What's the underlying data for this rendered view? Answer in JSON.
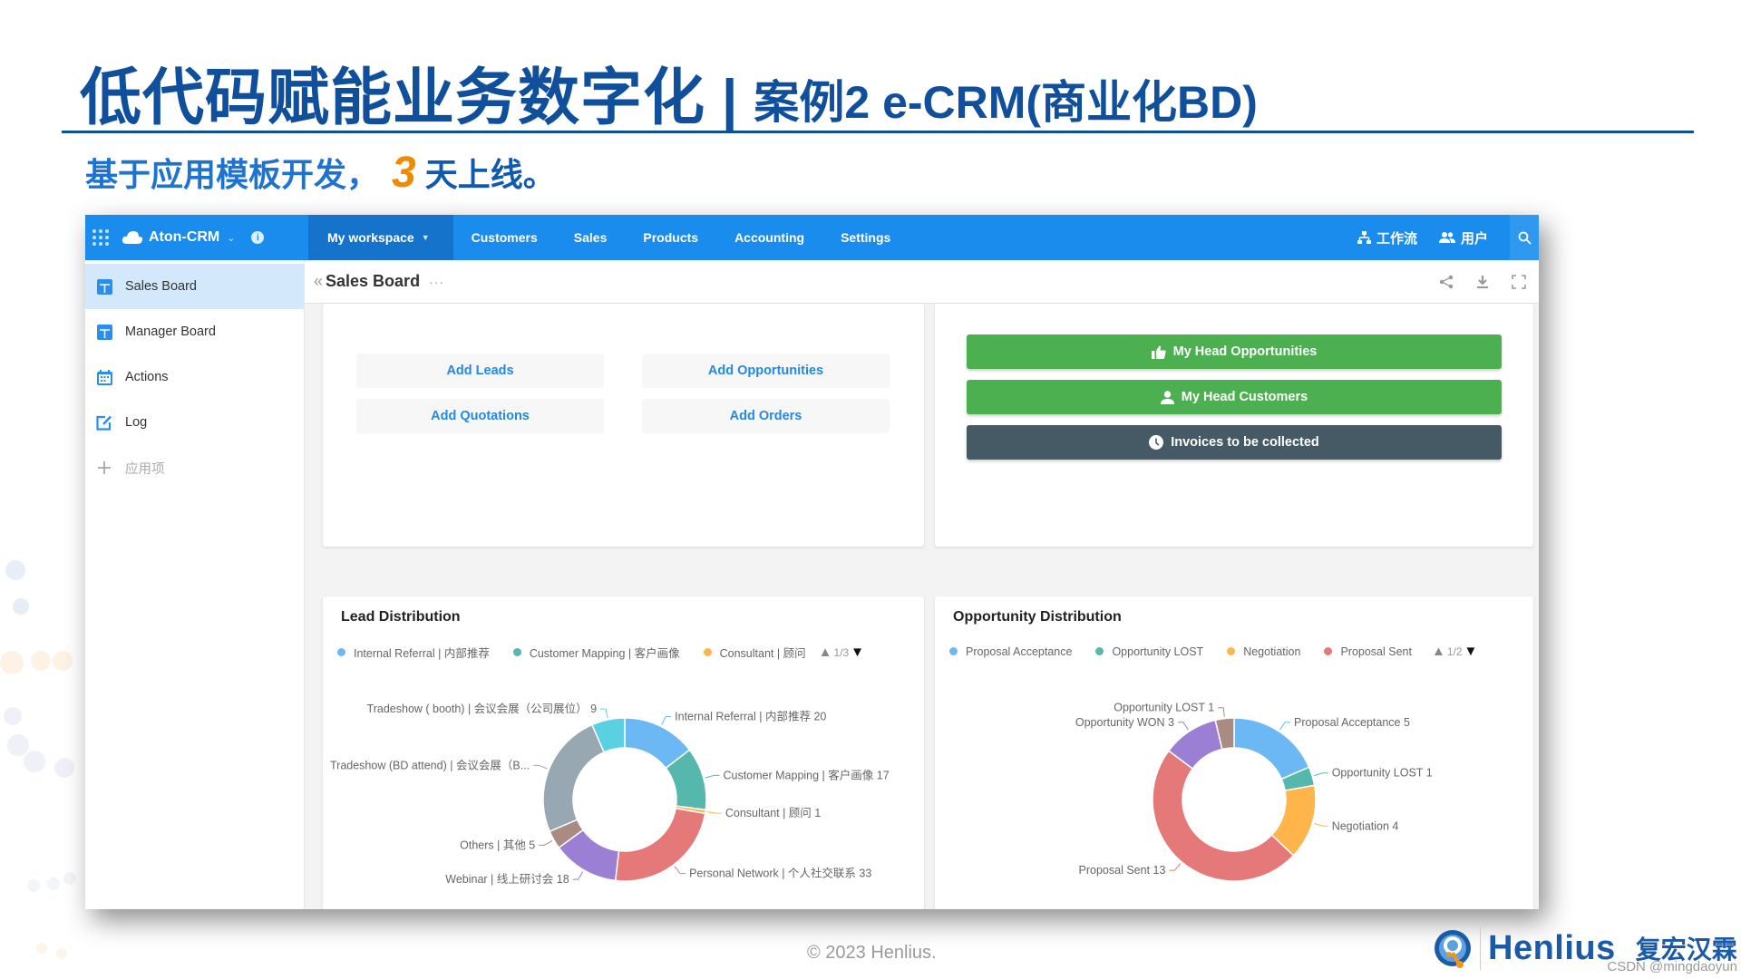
{
  "slide": {
    "title_main": "低代码赋能业务数字化",
    "title_sep": "|",
    "title_sub": "案例2 e-CRM(商业化BD)",
    "tagline_pre": "基于应用模板开发，",
    "tagline_num": "3",
    "tagline_post": "天上线。",
    "copyright": "© 2023 Henlius.",
    "logo_en": "Henlius",
    "logo_cn": "复宏汉霖",
    "watermark": "CSDN @mingdaoyun"
  },
  "app": {
    "name": "Aton-CRM",
    "info_icon": "i",
    "nav_tabs": [
      {
        "label": "My workspace",
        "active": true,
        "has_caret": true
      },
      {
        "label": "Customers"
      },
      {
        "label": "Sales"
      },
      {
        "label": "Products"
      },
      {
        "label": "Accounting"
      },
      {
        "label": "Settings"
      }
    ],
    "nav_right": {
      "workflow": "工作流",
      "users": "用户"
    },
    "colors": {
      "nav": "#1a8cee",
      "nav_active": "#1573cc",
      "green": "#4caf50",
      "slate": "#455a64",
      "link": "#2289e6"
    }
  },
  "sidebar": {
    "items": [
      {
        "label": "Sales Board",
        "icon": "board-icon",
        "active": true
      },
      {
        "label": "Manager Board",
        "icon": "board-icon"
      },
      {
        "label": "Actions",
        "icon": "calendar-icon"
      },
      {
        "label": "Log",
        "icon": "edit-icon"
      }
    ],
    "add_label": "应用项"
  },
  "page": {
    "title": "Sales Board",
    "more": "···"
  },
  "quick_actions": [
    "Add Leads",
    "Add Opportunities",
    "Add Quotations",
    "Add Orders"
  ],
  "shortcuts": [
    {
      "label": "My Head Opportunities",
      "icon": "thumbs-up-icon",
      "color": "#4caf50"
    },
    {
      "label": "My Head Customers",
      "icon": "person-icon",
      "color": "#4caf50"
    },
    {
      "label": "Invoices to be collected",
      "icon": "clock-icon",
      "color": "#455a64"
    }
  ],
  "chart_data": [
    {
      "type": "pie",
      "variant": "donut",
      "title": "Lead Distribution",
      "legend": {
        "visible_items": [
          "Internal Referral | 内部推荐",
          "Customer Mapping | 客户画像",
          "Consultant | 顾问"
        ],
        "page": "1/3",
        "placement": "top-left"
      },
      "slices": [
        {
          "label": "Internal Referral | 内部推荐",
          "value": 20,
          "color": "#6cb8f5",
          "shown": "Internal Referral | 内部推荐  20"
        },
        {
          "label": "Customer Mapping | 客户画像",
          "value": 17,
          "color": "#56b8ad",
          "shown": "Customer Mapping | 客户画像  17"
        },
        {
          "label": "Consultant | 顾问",
          "value": 1,
          "color": "#ffb54a",
          "shown": "Consultant | 顾问  1"
        },
        {
          "label": "Personal Network | 个人社交联系",
          "value": 33,
          "color": "#e57878",
          "shown": "Personal Network | 个人社交联系  33"
        },
        {
          "label": "Webinar | 线上研讨会",
          "value": 18,
          "color": "#9b7fd4",
          "shown": "Webinar | 线上研讨会  18"
        },
        {
          "label": "Others | 其他",
          "value": 5,
          "color": "#a98b82",
          "shown": "Others | 其他  5"
        },
        {
          "label": "Tradeshow (BD attend) | 会议会展（B...",
          "value": 34,
          "color": "#98a8b2",
          "shown": "Tradeshow (BD attend) | 会议会展（B..."
        },
        {
          "label": "Tradeshow ( booth) | 会议会展（公司展位）",
          "value": 9,
          "color": "#5ad1e2",
          "shown": "Tradeshow ( booth) | 会议会展（公司展位）  9"
        }
      ]
    },
    {
      "type": "pie",
      "variant": "donut",
      "title": "Opportunity Distribution",
      "legend": {
        "visible_items": [
          "Proposal Acceptance",
          "Opportunity LOST",
          "Negotiation",
          "Proposal Sent"
        ],
        "page": "1/2",
        "placement": "top-left"
      },
      "slices": [
        {
          "label": "Proposal Acceptance",
          "value": 5,
          "color": "#6cb8f5",
          "shown": "Proposal Acceptance  5"
        },
        {
          "label": "Opportunity LOST",
          "value": 1,
          "color": "#56b8ad",
          "shown": "Opportunity LOST  1"
        },
        {
          "label": "Negotiation",
          "value": 4,
          "color": "#ffb54a",
          "shown": "Negotiation  4"
        },
        {
          "label": "Proposal Sent",
          "value": 13,
          "color": "#e57878",
          "shown": "Proposal Sent  13"
        },
        {
          "label": "Opportunity WON",
          "value": 3,
          "color": "#9b7fd4",
          "shown": "Opportunity WON  3"
        },
        {
          "label": "Opportunity LOST",
          "value": 1,
          "color": "#a98b82",
          "shown": "Opportunity LOST  1"
        }
      ]
    }
  ]
}
